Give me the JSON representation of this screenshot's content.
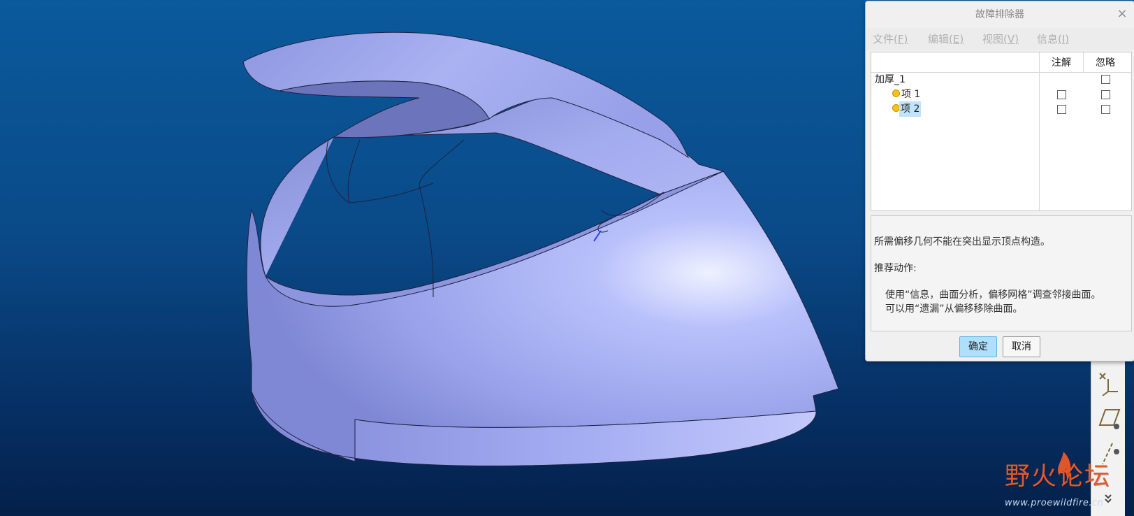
{
  "dialog": {
    "title": "故障排除器",
    "close_glyph": "×",
    "menu": [
      {
        "label": "文件",
        "mnemonic": "(F)"
      },
      {
        "label": "编辑",
        "mnemonic": "(E)"
      },
      {
        "label": "视图",
        "mnemonic": "(V)"
      },
      {
        "label": "信息",
        "mnemonic": "(I)"
      }
    ],
    "columns": {
      "note": "注解",
      "ignore": "忽略"
    },
    "tree": [
      {
        "label": "加厚_1",
        "level": 0,
        "has_note_checkbox": false,
        "note_checked": false,
        "ignore_checked": false,
        "selected": false
      },
      {
        "label": "项 1",
        "level": 1,
        "has_note_checkbox": true,
        "note_checked": false,
        "ignore_checked": false,
        "selected": false
      },
      {
        "label": "项 2",
        "level": 1,
        "has_note_checkbox": true,
        "note_checked": false,
        "ignore_checked": false,
        "selected": true
      }
    ],
    "message": {
      "problem": "所需偏移几何不能在突出显示顶点构造。",
      "action_heading": "推荐动作:",
      "action_line1": "使用“信息，曲面分析，偏移网格”调查邻接曲面。",
      "action_line2": "可以用“遗漏”从偏移移除曲面。"
    },
    "ok_label": "确定",
    "cancel_label": "取消"
  },
  "watermark": {
    "title": "野火论坛",
    "url": "www.proewildfire.cn"
  },
  "toolbar": {
    "icons": [
      "csys-icon",
      "datum-plane-icon",
      "datum-axis-icon",
      "expand-chevron-icon"
    ]
  },
  "colors": {
    "background_top": "#0a5a9c",
    "background_bottom": "#04204a",
    "model_surface": "#a3abef",
    "selection": "#bfe3fb",
    "ok_button": "#aee0fb"
  }
}
